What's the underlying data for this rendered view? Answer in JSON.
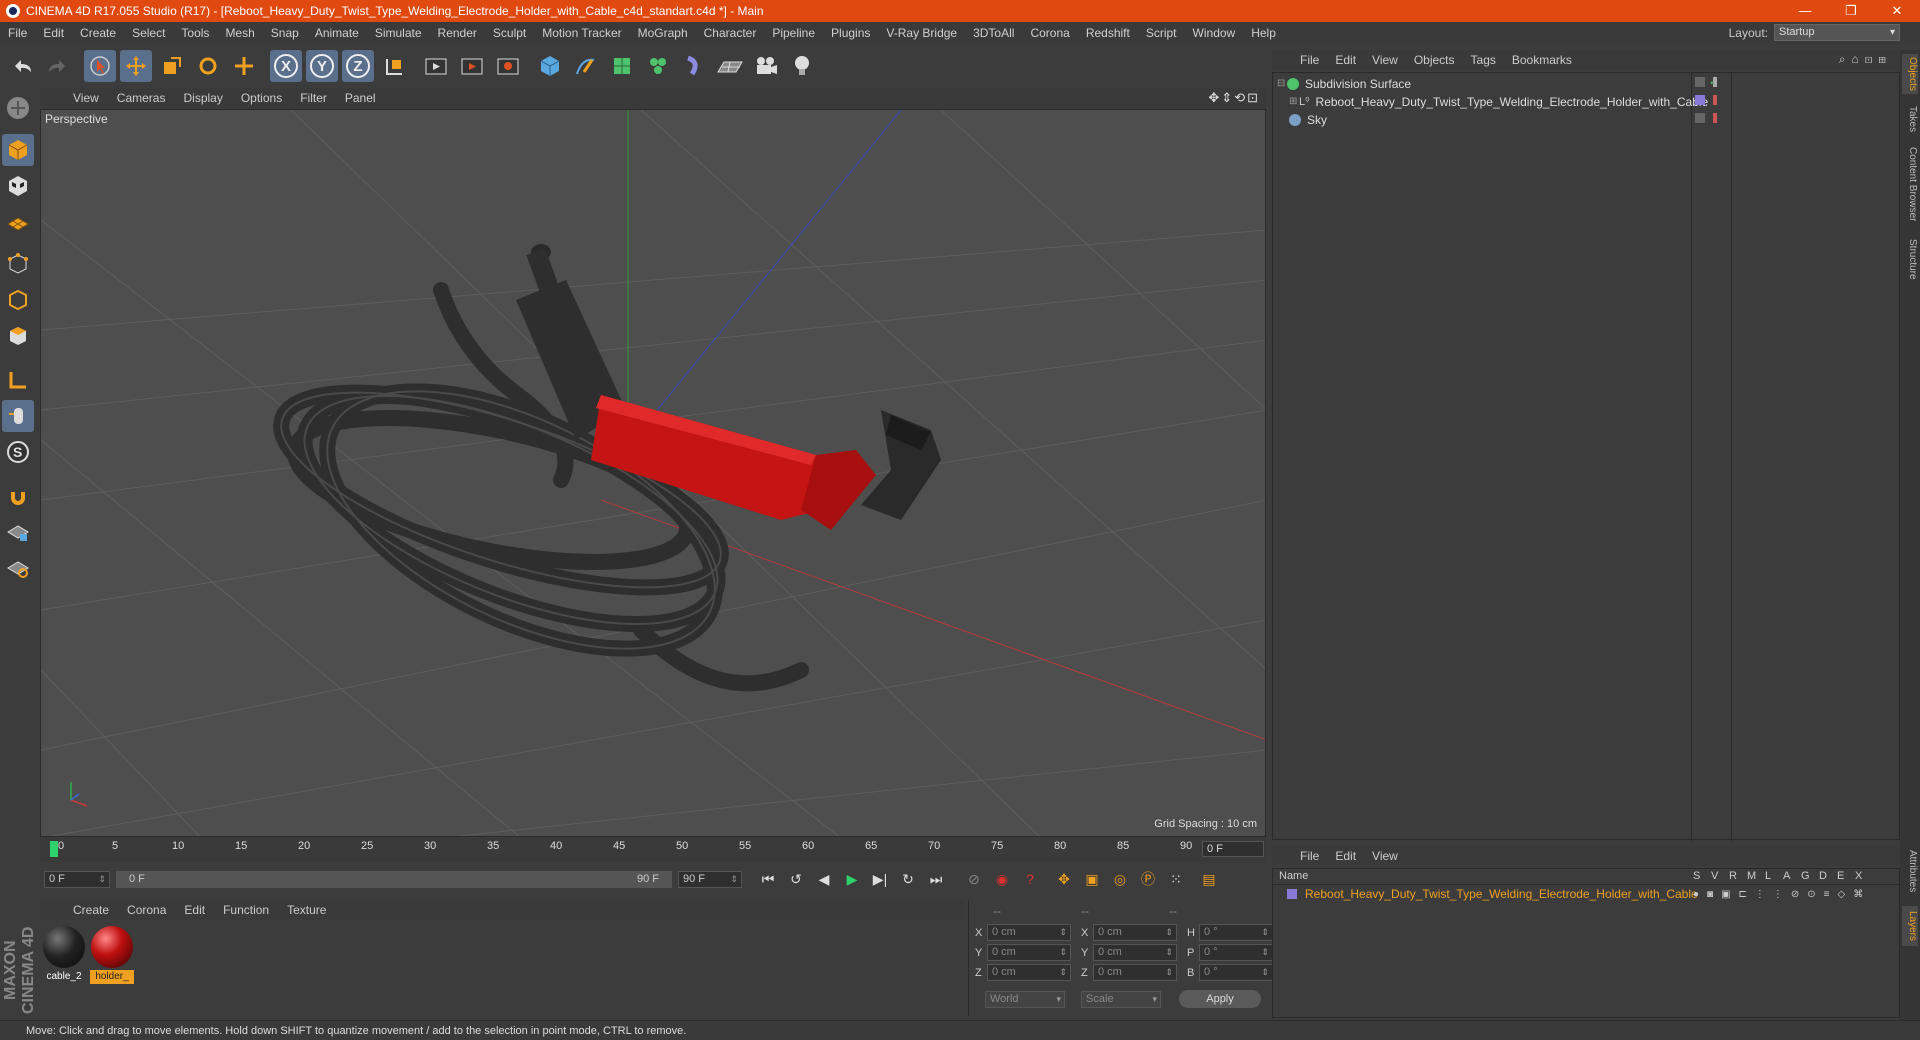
{
  "window": {
    "title": "CINEMA 4D R17.055 Studio (R17) - [Reboot_Heavy_Duty_Twist_Type_Welding_Electrode_Holder_with_Cable_c4d_standart.c4d *] - Main",
    "minimize": "—",
    "maximize": "❐",
    "close": "✕"
  },
  "menu": [
    "File",
    "Edit",
    "Create",
    "Select",
    "Tools",
    "Mesh",
    "Snap",
    "Animate",
    "Simulate",
    "Render",
    "Sculpt",
    "Motion Tracker",
    "MoGraph",
    "Character",
    "Pipeline",
    "Plugins",
    "V-Ray Bridge",
    "3DToAll",
    "Corona",
    "Redshift",
    "Script",
    "Window",
    "Help"
  ],
  "layout": {
    "label": "Layout:",
    "value": "Startup"
  },
  "toolbar": {
    "axis_x": "X",
    "axis_y": "Y",
    "axis_z": "Z"
  },
  "viewport": {
    "menu": [
      "View",
      "Cameras",
      "Display",
      "Options",
      "Filter",
      "Panel"
    ],
    "camera": "Perspective",
    "grid_spacing": "Grid Spacing : 10 cm",
    "nav_icons": "✥⇕⟲⊡"
  },
  "timeline": {
    "ticks": [
      "0",
      "5",
      "10",
      "15",
      "20",
      "25",
      "30",
      "35",
      "40",
      "45",
      "50",
      "55",
      "60",
      "65",
      "70",
      "75",
      "80",
      "85",
      "90"
    ],
    "current_frame": "0 F",
    "start_field": "0 F",
    "range_start": "0 F",
    "range_end": "90 F",
    "end_field": "90 F"
  },
  "materials": {
    "menu": [
      "Create",
      "Corona",
      "Edit",
      "Function",
      "Texture"
    ],
    "items": [
      {
        "name": "cable_2",
        "color": "#1a1a1a"
      },
      {
        "name": "holder_",
        "color": "#b01010"
      }
    ]
  },
  "coords": {
    "header": [
      "--",
      "--",
      "--"
    ],
    "rows": [
      {
        "a": "X",
        "v1": "0 cm",
        "b": "X",
        "v2": "0 cm",
        "c": "H",
        "v3": "0 °"
      },
      {
        "a": "Y",
        "v1": "0 cm",
        "b": "Y",
        "v2": "0 cm",
        "c": "P",
        "v3": "0 °"
      },
      {
        "a": "Z",
        "v1": "0 cm",
        "b": "Z",
        "v2": "0 cm",
        "c": "B",
        "v3": "0 °"
      }
    ],
    "mode": "World",
    "type": "Scale",
    "apply": "Apply"
  },
  "brand": "MAXON CINEMA 4D",
  "status": "Move: Click and drag to move elements. Hold down SHIFT to quantize movement / add to the selection in point mode, CTRL to remove.",
  "objects": {
    "menu": [
      "File",
      "Edit",
      "View",
      "Objects",
      "Tags",
      "Bookmarks"
    ],
    "items": [
      {
        "name": "Subdivision Surface",
        "color": "#4fc36b"
      },
      {
        "name": "Reboot_Heavy_Duty_Twist_Type_Welding_Electrode_Holder_with_Cable",
        "color": "#8a8aa0"
      },
      {
        "name": "Sky",
        "color": "#7aa0c8"
      }
    ]
  },
  "layers": {
    "menu": [
      "File",
      "Edit",
      "View"
    ],
    "columns": [
      "Name",
      "S",
      "V",
      "R",
      "M",
      "L",
      "A",
      "G",
      "D",
      "E",
      "X"
    ],
    "items": [
      {
        "name": "Reboot_Heavy_Duty_Twist_Type_Welding_Electrode_Holder_with_Cable",
        "color": "#8a7ad8"
      }
    ]
  },
  "side_tabs": [
    "Objects",
    "Takes",
    "Content Browser",
    "Structure"
  ],
  "side_tabs_bottom": [
    "Attributes",
    "Layers"
  ]
}
